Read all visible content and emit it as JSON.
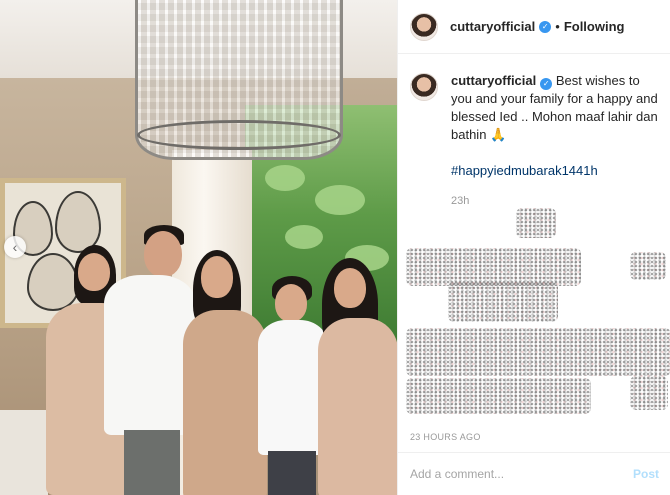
{
  "photo": {
    "nav_prev_icon": "chevron-left-icon",
    "nav_prev_glyph": "‹"
  },
  "header": {
    "username": "cuttaryofficial",
    "verified_icon": "verified-badge-icon",
    "separator": "•",
    "follow_status": "Following"
  },
  "caption": {
    "username": "cuttaryofficial",
    "text": "Best wishes to you and your family for a happy and blessed Ied .. Mohon maaf lahir dan bathin",
    "emoji": "🙏",
    "hashtag": "#happyiedmubarak1441h",
    "time_ago": "23h"
  },
  "post": {
    "timestamp": "23 HOURS AGO"
  },
  "comment": {
    "placeholder": "Add a comment...",
    "post_label": "Post"
  },
  "colors": {
    "link": "#003569",
    "verified": "#3897f0",
    "post_button_disabled": "#b2dffc"
  }
}
